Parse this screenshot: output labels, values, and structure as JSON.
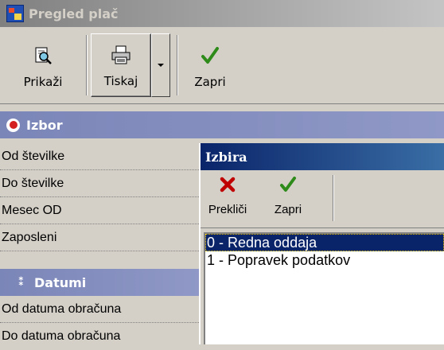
{
  "window": {
    "title": "Pregled plač",
    "icon": "app-icon"
  },
  "toolbar": {
    "show_label": "Prikaži",
    "print_label": "Tiskaj",
    "close_label": "Zapri",
    "icons": {
      "show": "preview-magnifier-icon",
      "print": "printer-icon",
      "close": "checkmark-icon"
    }
  },
  "groups": {
    "izbor": {
      "label": "Izbor",
      "icon": "collapse-circle-icon"
    },
    "datumi": {
      "label": "Datumi",
      "icon": "grip-dots-icon"
    }
  },
  "properties": {
    "od_stevilke": "Od številke",
    "do_stevilke": "Do številke",
    "mesec_od": "Mesec OD",
    "zaposleni": "Zaposleni",
    "od_datuma": "Od datuma obračuna",
    "do_datuma": "Do datuma obračuna"
  },
  "dialog": {
    "title": "Izbira",
    "cancel_label": "Prekliči",
    "close_label": "Zapri",
    "items": [
      "0 - Redna oddaja",
      "1 - Popravek podatkov"
    ],
    "selected_index": 0
  },
  "colors": {
    "accent_check": "#2e8b1a",
    "cancel_x": "#c00000",
    "group_header": "#8a93c2",
    "selection": "#0a246a"
  }
}
